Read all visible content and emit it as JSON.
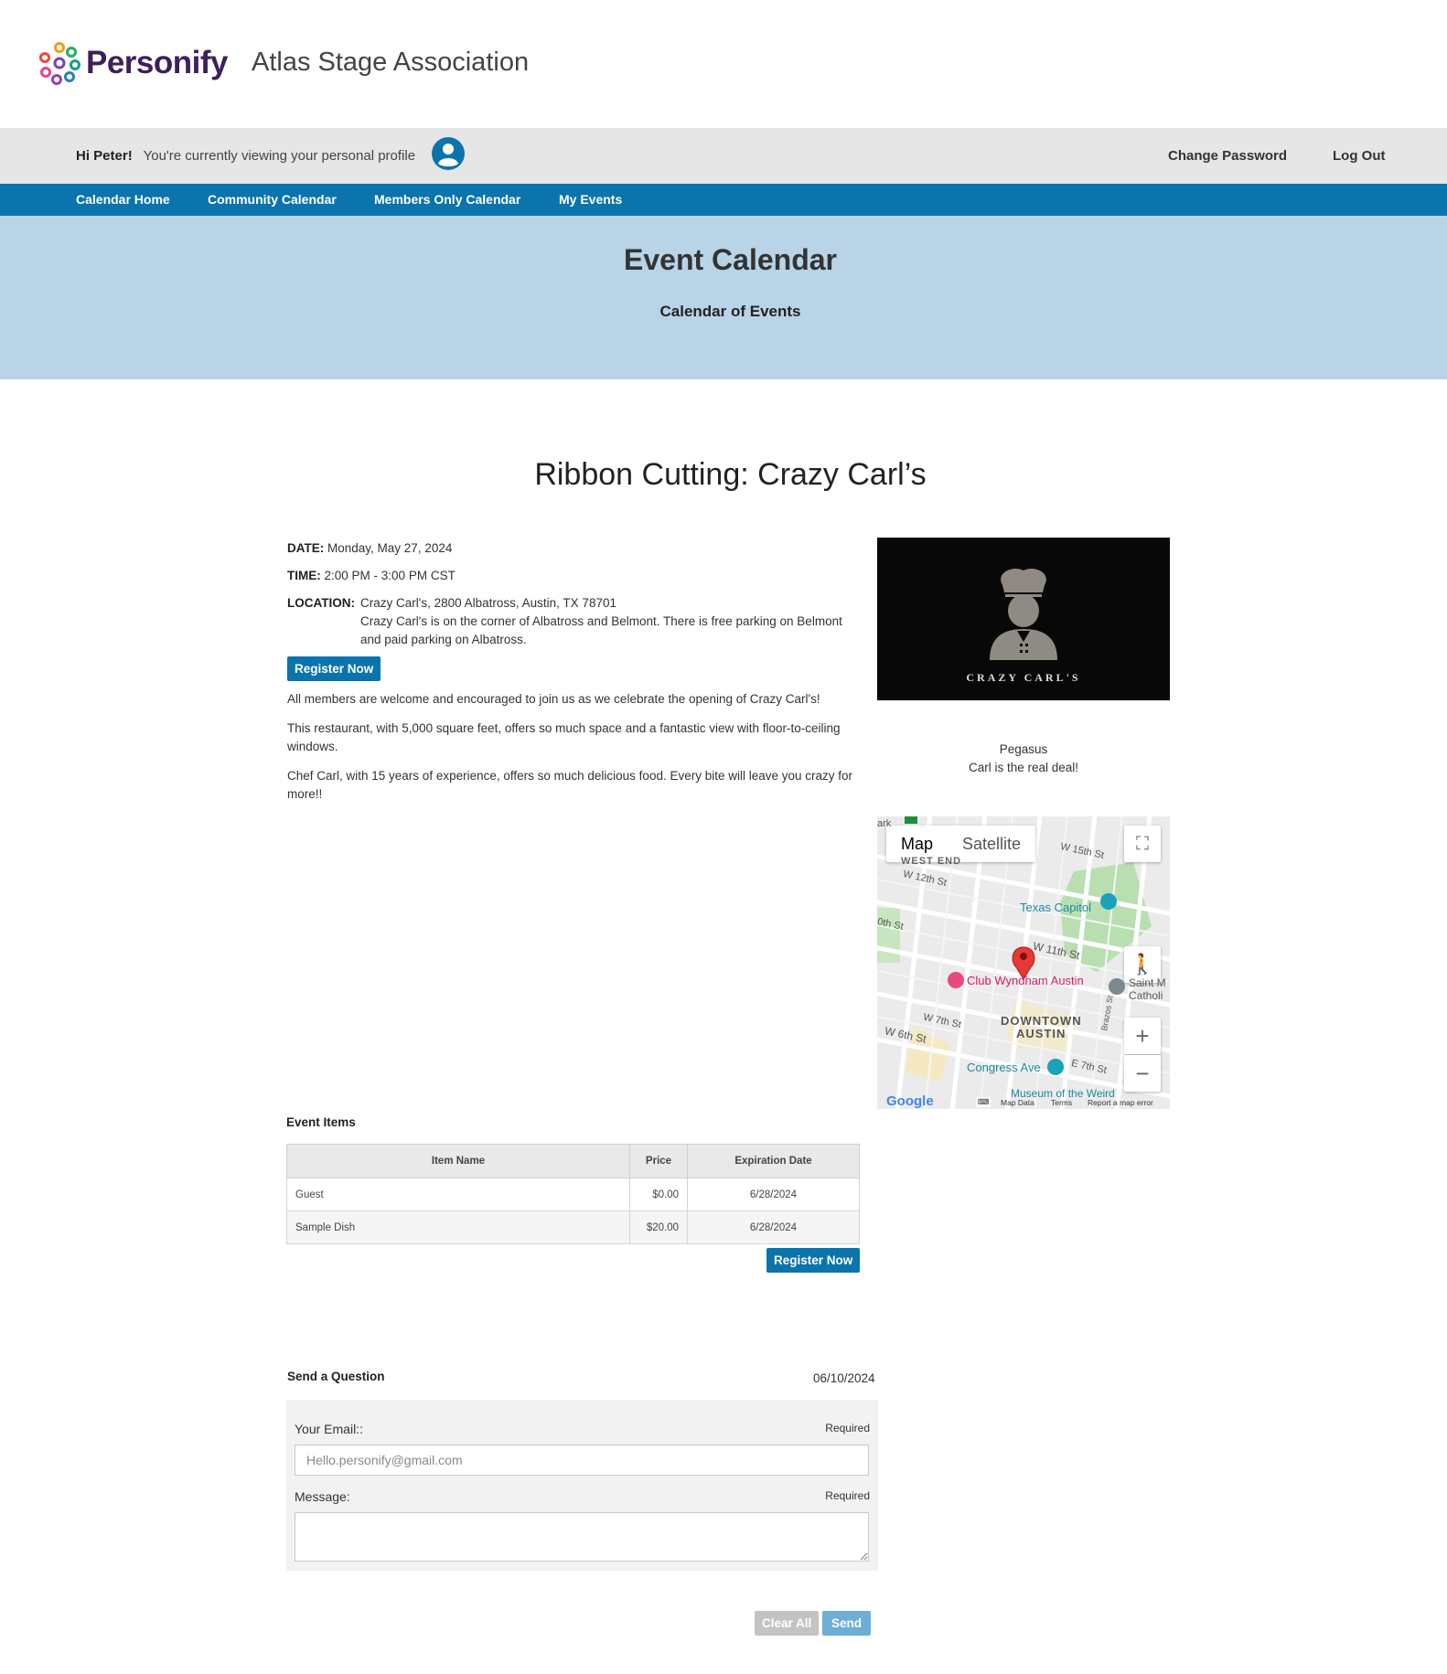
{
  "header": {
    "logo_text": "Personify",
    "org_name": "Atlas Stage Association"
  },
  "profile_bar": {
    "greeting": "Hi Peter!",
    "viewing_text": "You're currently viewing your personal profile",
    "change_password": "Change Password",
    "log_out": "Log Out"
  },
  "nav": {
    "items": [
      "Calendar Home",
      "Community Calendar",
      "Members Only Calendar",
      "My Events"
    ]
  },
  "banner": {
    "title": "Event Calendar",
    "subtitle": "Calendar of Events"
  },
  "event": {
    "title": "Ribbon Cutting: Crazy Carl’s",
    "date_label": "DATE:",
    "date_value": "Monday, May 27, 2024",
    "time_label": "TIME:",
    "time_value": "2:00 PM - 3:00 PM CST",
    "location_label": "LOCATION:",
    "location_line1": "Crazy Carl's, 2800 Albatross, Austin, TX 78701",
    "location_line2": "Crazy Carl's is on the corner of Albatross and Belmont. There is free parking on Belmont and paid parking on Albatross.",
    "register_label": "Register Now",
    "paragraphs": [
      "All members are welcome and encouraged to join us as we celebrate the opening of Crazy Carl's!",
      "This restaurant, with 5,000 square feet, offers so much space and a fantastic view with floor-to-ceiling windows.",
      "Chef Carl, with 15 years of experience, offers so much delicious food. Every bite will leave you crazy for more!!"
    ],
    "image_brand": "CRAZY CARL'S",
    "caption_line1": "Pegasus",
    "caption_line2": "Carl is the real deal!"
  },
  "map": {
    "map_tab": "Map",
    "satellite_tab": "Satellite",
    "labels": {
      "west_end": "WEST END",
      "w12": "W 12th St",
      "w15": "W 15th St",
      "w11": "W 11th St",
      "w7": "W 7th St",
      "w6": "W 6th St",
      "e7": "E 7th St",
      "tenth": "0th St",
      "downtown1": "DOWNTOWN",
      "downtown2": "AUSTIN",
      "texas_capitol": "Texas Capitol",
      "club_wyndham": "Club Wyndham Austin",
      "congress": "Congress Ave",
      "saint": "Saint M",
      "catholic": "Catholi",
      "museum": "Museum of the Weird",
      "brazos": "Brazos St",
      "ark": "ark"
    },
    "google": "Google",
    "footer_data": "Map Data",
    "footer_terms": "Terms",
    "footer_report": "Report a map error"
  },
  "event_items": {
    "title": "Event Items",
    "columns": [
      "Item Name",
      "Price",
      "Expiration Date"
    ],
    "rows": [
      {
        "name": "Guest",
        "price": "$0.00",
        "expiration": "6/28/2024"
      },
      {
        "name": "Sample Dish",
        "price": "$20.00",
        "expiration": "6/28/2024"
      }
    ],
    "register_label": "Register Now"
  },
  "question": {
    "title": "Send a Question",
    "date": "06/10/2024",
    "email_label": "Your Email::",
    "email_required": "Required",
    "email_placeholder": "Hello.personify@gmail.com",
    "message_label": "Message:",
    "message_required": "Required",
    "clear_label": "Clear All",
    "send_label": "Send"
  },
  "colors": {
    "nav_blue": "#0b74ad",
    "banner_blue": "#b8d4e6",
    "profile_bar_gray": "#e6e6e6",
    "map_pin_red": "#e53935"
  }
}
